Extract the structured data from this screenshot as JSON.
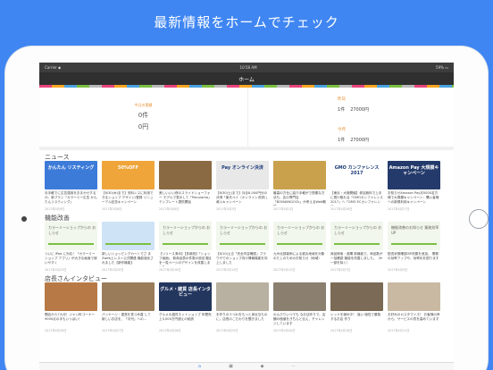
{
  "headline": "最新情報をホームでチェック",
  "status": {
    "carrier": "Carrier ◆",
    "time": "10:58 AM",
    "battery": "59% ▭"
  },
  "nav": {
    "title": "ホーム"
  },
  "summary": {
    "label": "今日の実績",
    "count": "0件",
    "amount": "0円",
    "months": [
      {
        "label": "昨日",
        "count": "1件",
        "amount": "27000円"
      },
      {
        "label": "今月",
        "count": "1件",
        "amount": "27000円"
      }
    ]
  },
  "news": {
    "title": "ニュース",
    "items": [
      {
        "thumb_text": "かんたん\nリスティング",
        "color": "#3d7bd9",
        "caption": "月手軽でに広告運用をおまかせするか。新プラン「カラーミー広告 かんたんリスティング」",
        "date": "2017年5月9日"
      },
      {
        "thumb_text": "50%OFF",
        "color": "#f0a53a",
        "caption": "【6/30(木)まで】安料レスに利用できるショップ デザイン/登録 リニューアル記念キャンペーン",
        "date": "2017年5月8日"
      },
      {
        "thumb_text": "",
        "color": "#8a6a42",
        "caption": "美しいいい夜のスライドショーフォー モデルで表示して「Panorama」テンプレート提供開始",
        "date": "2017年5月8日"
      },
      {
        "thumb_text": "Pay オンライン決済",
        "color": "#e8e8e8",
        "caption": "【6/30(土)まで】月合8,000円分の決済「楽天ペイ（オンライン決済）」導入キャンペーン",
        "date": "2017年5月2日"
      },
      {
        "thumb_text": "",
        "color": "#c9a14c",
        "caption": "最高の方仕に紹介手軽がで簡素な方法も、店の専門店「BOYAKINGOOL」が考えるWeb戦略",
        "date": "2017年5月1日"
      },
      {
        "thumb_text": "GMO カンファレンス 2017",
        "color": "#ffffff",
        "caption": "【東京・大阪開催】参加無料で上手に受け取れる「GMOカンファレンス 2017」へ「GMO ECカンファレンス」",
        "date": "2017年4月28日"
      },
      {
        "thumb_text": "Amazon Pay 大規模キャンペーン",
        "color": "#243a6b",
        "caption": "お知らせAmazon Pay月5000名方様で大規模キャンペーン：購入者様への新規利用キャンペーン",
        "date": "2017年4月27日"
      }
    ]
  },
  "features": {
    "title": "機能改善",
    "items": [
      {
        "thumb_text": "カラーミーショップからの\nおしらせ",
        "caption": "ついに iPad に対応！「カラーミーショップ アプリ」が大きな画面で使いやすく",
        "date": "2017年4月25日"
      },
      {
        "thumb_text": "",
        "caption": "新しいショッピングカートでさ まZweb上レスト公式関連 機能強化されました【新作機能】",
        "date": "2017年4月20日"
      },
      {
        "thumb_text": "カラーミーショップからの\nおしらせ",
        "caption": "【リリース済み】【多新設】「ショップ画面」 新商品表示件数の設定項目を一覧ページのデザインを改善しました",
        "date": "2017年4月18日"
      },
      {
        "thumb_text": "カラーミーショップからの\nおしらせ",
        "caption": "【6/10(土)】「安全内容確認」ブラウザでのショップ向け情報機能を向上しました",
        "date": "2017年4月13日"
      },
      {
        "thumb_text": "カラーミーショップからの\nおしらせ",
        "caption": "九州北部豪雨による被災地域を対象 のたしのためのお知らせ（地域）",
        "date": "2017年4月12日"
      },
      {
        "thumb_text": "カラーミーショップからの\nおしらせ",
        "caption": "商品検索・各購 新機能で、商品数が一括確認 機能を改善しました。（※一部を除く）",
        "date": "2017年4月7日"
      },
      {
        "thumb_text": "機能改善のお知らせ 業務効率UP",
        "caption": "配送状態確認ISP改善を追加。 業務の効率アップや、効率化を図ります",
        "date": "2017年4月5日"
      }
    ]
  },
  "interviews": {
    "title": "店長さんインタビュー",
    "items": [
      {
        "thumb_text": "",
        "color": "#b77a46",
        "caption": "開店から7カ月！ジャン料コーナー9000点の手もいっぱい！",
        "date": "2017年4月28日"
      },
      {
        "thumb_text": "",
        "color": "#9a7c5a",
        "caption": "パッケージ・運営を見つめ直 して 新しいお店を、「月刊」への...",
        "date": "2017年4月27日"
      },
      {
        "thumb_text": "グルメ・雑貨 店長インタビュー",
        "color": "#23365e",
        "caption": "グルメ＆雑貨ネットショップ 年間売上3,000万円超えの秘訣",
        "date": "2017年4月26日"
      },
      {
        "thumb_text": "",
        "color": "#b8b0a0",
        "caption": "手作りのうつわをもっと身近なものに。店長のこだわりを聞きました",
        "date": "2017年4月25日"
      },
      {
        "thumb_text": "",
        "color": "#8b7f70",
        "caption": "のんびりいつでも なお店作りで、店舗の価値をきちんと伝え、チャレンジしています",
        "date": "2017年4月20日"
      },
      {
        "thumb_text": "",
        "color": "#7b6a55",
        "caption": "レッドを極めタ！ 強い 個性で勝負するお店 作り",
        "date": "2017年4月18日"
      },
      {
        "thumb_text": "",
        "color": "#c9b9a3",
        "caption": "お好みのカスタマイズ！ お客様の声から、サービスの質を高めています",
        "date": "2017年4月12日"
      }
    ]
  },
  "tabs": [
    {
      "icon": "home-icon",
      "glyph": "⌂"
    },
    {
      "icon": "document-icon",
      "glyph": "▣"
    },
    {
      "icon": "tag-icon",
      "glyph": "◆"
    },
    {
      "icon": "more-icon",
      "glyph": "⋯"
    }
  ]
}
